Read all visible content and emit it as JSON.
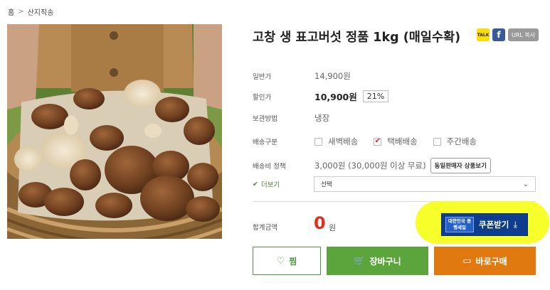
{
  "breadcrumb": {
    "home": "홈",
    "separator": ">",
    "category": "산지직송"
  },
  "product": {
    "title": "고창 생 표고버섯 정품 1kg (매일수확)"
  },
  "share": {
    "kakao": "TALK",
    "facebook": "f",
    "url_copy": "URL 복사"
  },
  "info": {
    "regular_label": "일반가",
    "regular_price": "14,900원",
    "sale_label": "할인가",
    "sale_price": "10,900원",
    "discount_rate": "21%",
    "storage_label": "보관방법",
    "storage_value": "냉장",
    "shipping_type_label": "배송구분",
    "shipping_options": [
      {
        "label": "새벽배송",
        "checked": false
      },
      {
        "label": "택배배송",
        "checked": true
      },
      {
        "label": "주간배송",
        "checked": false
      }
    ],
    "shipping_fee_label": "배송비 정책",
    "shipping_fee_value": "3,000원 (30,000원 이상 무료)",
    "same_seller_button": "동일판매자 상품보기"
  },
  "options": {
    "more_label": "더보기",
    "select_value": "선택"
  },
  "total": {
    "label": "합계금액",
    "value": "0",
    "unit": "원"
  },
  "coupon": {
    "badge": "대한민국 동행세일",
    "label": "쿠폰받기"
  },
  "actions": {
    "wish": "찜",
    "cart": "장바구니",
    "buy": "바로구매"
  },
  "colors": {
    "accent_green": "#5ba53c",
    "buy_orange": "#e07a10",
    "price_red": "#e0301e",
    "coupon_navy": "#0d3d8c",
    "highlight_yellow": "#f6ff1e"
  }
}
